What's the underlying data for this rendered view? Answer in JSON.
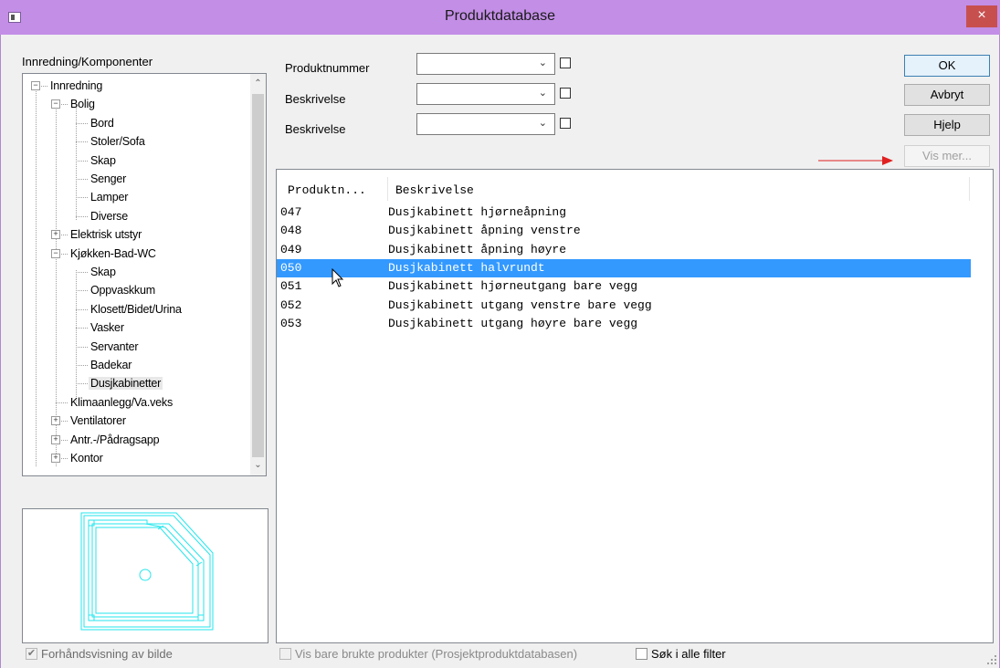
{
  "window": {
    "title": "Produktdatabase",
    "close_glyph": "×"
  },
  "tree": {
    "label": "Innredning/Komponenter",
    "items": [
      {
        "label": "Innredning",
        "level": 0,
        "expander": "−"
      },
      {
        "label": "Bolig",
        "level": 1,
        "expander": "−"
      },
      {
        "label": "Bord",
        "level": 2
      },
      {
        "label": "Stoler/Sofa",
        "level": 2
      },
      {
        "label": "Skap",
        "level": 2
      },
      {
        "label": "Senger",
        "level": 2
      },
      {
        "label": "Lamper",
        "level": 2
      },
      {
        "label": "Diverse",
        "level": 2
      },
      {
        "label": "Elektrisk utstyr",
        "level": 1,
        "expander": "+"
      },
      {
        "label": "Kjøkken-Bad-WC",
        "level": 1,
        "expander": "−"
      },
      {
        "label": "Skap",
        "level": 2
      },
      {
        "label": "Oppvaskkum",
        "level": 2
      },
      {
        "label": "Klosett/Bidet/Urina",
        "level": 2
      },
      {
        "label": "Vasker",
        "level": 2
      },
      {
        "label": "Servanter",
        "level": 2
      },
      {
        "label": "Badekar",
        "level": 2
      },
      {
        "label": "Dusjkabinetter",
        "level": 2,
        "selected": true
      },
      {
        "label": "Klimaanlegg/Va.veks",
        "level": 1
      },
      {
        "label": "Ventilatorer",
        "level": 1,
        "expander": "+"
      },
      {
        "label": "Antr.-/Pådragsapp",
        "level": 1,
        "expander": "+"
      },
      {
        "label": "Kontor",
        "level": 1,
        "expander": "+"
      }
    ]
  },
  "preview_checkbox": {
    "label": "Forhåndsvisning av bilde",
    "checked": true,
    "mark": "✔"
  },
  "filters": [
    {
      "label": "Produktnummer",
      "value": ""
    },
    {
      "label": "Beskrivelse",
      "value": ""
    },
    {
      "label": "Beskrivelse",
      "value": ""
    }
  ],
  "buttons": {
    "ok": "OK",
    "cancel": "Avbryt",
    "help": "Hjelp",
    "more": "Vis mer..."
  },
  "list": {
    "columns": [
      "Produktn...",
      "Beskrivelse"
    ],
    "rows": [
      {
        "nr": "047",
        "desc": "Dusjkabinett hjørneåpning"
      },
      {
        "nr": "048",
        "desc": "Dusjkabinett åpning venstre"
      },
      {
        "nr": "049",
        "desc": "Dusjkabinett åpning høyre"
      },
      {
        "nr": "050",
        "desc": "Dusjkabinett halvrundt",
        "selected": true
      },
      {
        "nr": "051",
        "desc": "Dusjkabinett hjørneutgang bare vegg"
      },
      {
        "nr": "052",
        "desc": "Dusjkabinett utgang venstre bare vegg"
      },
      {
        "nr": "053",
        "desc": "Dusjkabinett utgang høyre bare vegg"
      }
    ]
  },
  "bottom": {
    "used_only": "Vis bare brukte produkter (Prosjektproduktdatabasen)",
    "search_all": "Søk i alle filter"
  },
  "colors": {
    "titlebar": "#c38ee6",
    "selection": "#3399ff",
    "preview_lines": "#26e6ec",
    "arrow": "#e02020"
  }
}
